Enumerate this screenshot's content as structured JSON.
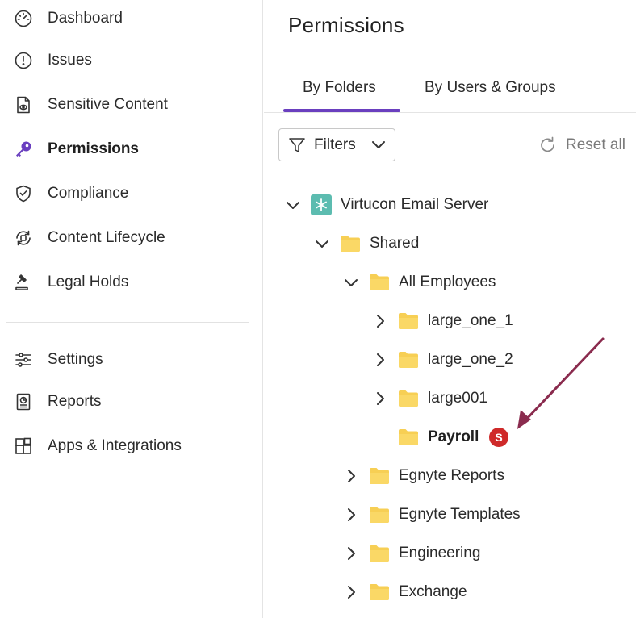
{
  "sidebar": {
    "items": [
      {
        "label": "Dashboard",
        "icon": "gauge-icon"
      },
      {
        "label": "Issues",
        "icon": "alert-circle-icon"
      },
      {
        "label": "Sensitive Content",
        "icon": "file-eye-icon"
      },
      {
        "label": "Permissions",
        "icon": "key-icon",
        "active": true
      },
      {
        "label": "Compliance",
        "icon": "shield-check-icon"
      },
      {
        "label": "Content Lifecycle",
        "icon": "lifecycle-icon"
      },
      {
        "label": "Legal Holds",
        "icon": "gavel-icon"
      }
    ],
    "secondary_items": [
      {
        "label": "Settings",
        "icon": "sliders-icon"
      },
      {
        "label": "Reports",
        "icon": "report-icon"
      },
      {
        "label": "Apps & Integrations",
        "icon": "apps-grid-icon"
      }
    ]
  },
  "main": {
    "title": "Permissions",
    "tabs": [
      {
        "label": "By Folders",
        "active": true
      },
      {
        "label": "By Users & Groups",
        "active": false
      }
    ],
    "filters_label": "Filters",
    "reset_label": "Reset all",
    "tree": [
      {
        "label": "Virtucon Email Server",
        "level": 0,
        "state": "expanded",
        "icon": "server-icon"
      },
      {
        "label": "Shared",
        "level": 1,
        "state": "expanded",
        "icon": "folder-icon"
      },
      {
        "label": "All Employees",
        "level": 2,
        "state": "expanded",
        "icon": "folder-icon"
      },
      {
        "label": "large_one_1",
        "level": 3,
        "state": "collapsed",
        "icon": "folder-icon"
      },
      {
        "label": "large_one_2",
        "level": 3,
        "state": "collapsed",
        "icon": "folder-icon"
      },
      {
        "label": "large001",
        "level": 3,
        "state": "collapsed",
        "icon": "folder-icon"
      },
      {
        "label": "Payroll",
        "level": 3,
        "state": "leaf",
        "icon": "folder-icon",
        "bold": true,
        "badge": "S"
      },
      {
        "label": "Egnyte Reports",
        "level": 2,
        "state": "collapsed",
        "icon": "folder-icon"
      },
      {
        "label": "Egnyte Templates",
        "level": 2,
        "state": "collapsed",
        "icon": "folder-icon"
      },
      {
        "label": "Engineering",
        "level": 2,
        "state": "collapsed",
        "icon": "folder-icon"
      },
      {
        "label": "Exchange",
        "level": 2,
        "state": "collapsed",
        "icon": "folder-icon"
      }
    ]
  },
  "colors": {
    "accent": "#6a3fbf",
    "folder": "#f7cf54",
    "server_tile": "#5cbcb0",
    "badge": "#cf2a2a",
    "annotation_arrow": "#8a2b4e"
  }
}
